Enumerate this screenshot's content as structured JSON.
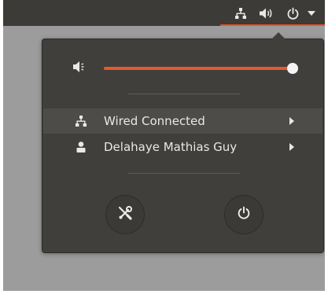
{
  "topbar": {
    "icons": [
      "network-wired-icon",
      "volume-icon",
      "power-icon",
      "dropdown-arrow-icon"
    ],
    "accent_color": "#e95420"
  },
  "volume": {
    "icon": "volume-low-icon",
    "level": 0.98
  },
  "menu": {
    "items": [
      {
        "icon": "network-wired-icon",
        "label": "Wired Connected",
        "has_submenu": true
      },
      {
        "icon": "user-icon",
        "label": "Delahaye Mathias Guy",
        "has_submenu": true
      }
    ],
    "buttons": [
      {
        "icon": "settings-icon",
        "name": "settings"
      },
      {
        "icon": "power-icon",
        "name": "power-off"
      }
    ]
  }
}
